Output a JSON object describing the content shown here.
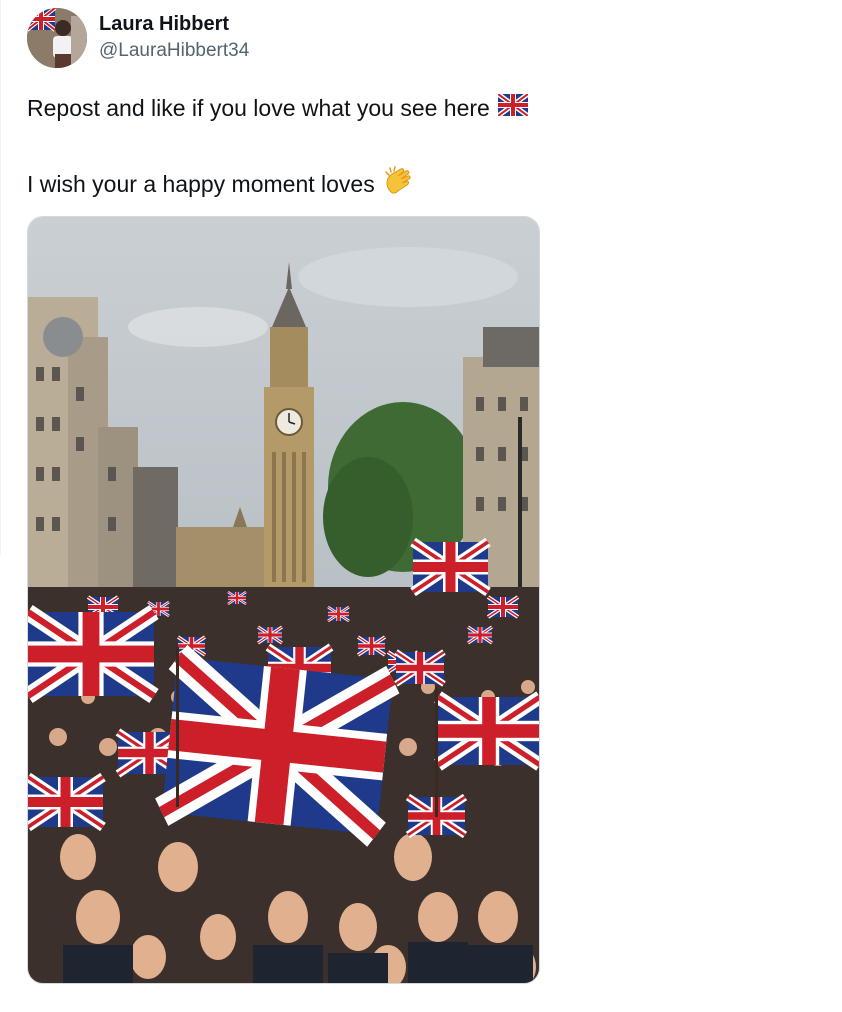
{
  "post": {
    "author": {
      "display_name": "Laura Hibbert",
      "handle": "@LauraHibbert34",
      "avatar_icon": "profile-avatar"
    },
    "text_lines": [
      "Repost and like if you love what you see here",
      "I wish your a happy moment loves"
    ],
    "emojis": [
      "uk-flag-emoji",
      "clapping-hands-emoji"
    ],
    "media": {
      "type": "image",
      "subject": "crowd waving Union Jack flags near Big Ben clock tower"
    }
  },
  "colors": {
    "text": "#0f1419",
    "secondary": "#536471",
    "flag_blue": "#1f3a8a",
    "flag_red": "#cc1f2a"
  }
}
